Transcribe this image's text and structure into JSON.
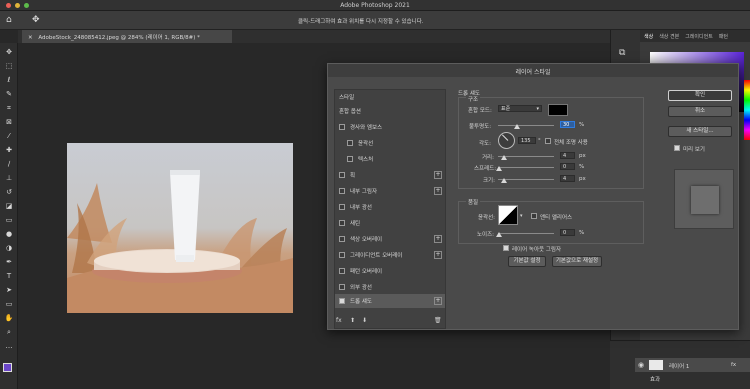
{
  "app": {
    "title": "Adobe Photoshop 2021"
  },
  "options_bar": {
    "hint": "클릭-드래그하여 효과 위치를 다시 지정할 수 있습니다."
  },
  "document": {
    "tab_label": "AdobeStock_248085412.jpeg @ 284% (레이어 1, RGB/8#) *"
  },
  "right_panel": {
    "tabs": [
      "색상",
      "색상 견본",
      "그레이디언트",
      "패턴"
    ]
  },
  "dialog": {
    "title": "레이어 스타일",
    "style_list": [
      {
        "label": "스타일",
        "checkbox": false,
        "checked": false,
        "plus": false,
        "selected": false
      },
      {
        "label": "혼합 옵션",
        "checkbox": false,
        "checked": false,
        "plus": false,
        "selected": false
      },
      {
        "label": "경사와 엠보스",
        "checkbox": true,
        "checked": false,
        "plus": false,
        "selected": false
      },
      {
        "label": "윤곽선",
        "checkbox": true,
        "checked": false,
        "plus": false,
        "selected": false,
        "indent": true
      },
      {
        "label": "텍스처",
        "checkbox": true,
        "checked": false,
        "plus": false,
        "selected": false,
        "indent": true
      },
      {
        "label": "획",
        "checkbox": true,
        "checked": false,
        "plus": true,
        "selected": false
      },
      {
        "label": "내부 그림자",
        "checkbox": true,
        "checked": false,
        "plus": true,
        "selected": false
      },
      {
        "label": "내부 광선",
        "checkbox": true,
        "checked": false,
        "plus": false,
        "selected": false
      },
      {
        "label": "새틴",
        "checkbox": true,
        "checked": false,
        "plus": false,
        "selected": false
      },
      {
        "label": "색상 오버레이",
        "checkbox": true,
        "checked": false,
        "plus": true,
        "selected": false
      },
      {
        "label": "그레이디언트 오버레이",
        "checkbox": true,
        "checked": false,
        "plus": true,
        "selected": false
      },
      {
        "label": "패턴 오버레이",
        "checkbox": true,
        "checked": false,
        "plus": false,
        "selected": false
      },
      {
        "label": "외부 광선",
        "checkbox": true,
        "checked": false,
        "plus": false,
        "selected": false
      },
      {
        "label": "드롭 섀도",
        "checkbox": true,
        "checked": true,
        "plus": true,
        "selected": true
      }
    ],
    "footer": {
      "fx": "fx",
      "up": "⬆",
      "down": "⬇",
      "trash": "🗑"
    },
    "drop_shadow": {
      "heading": "드롭 섀도",
      "structure_heading": "구조",
      "blend_mode_label": "혼합 모드:",
      "blend_mode_value": "표준",
      "shadow_color": "#000000",
      "opacity_label": "불투명도:",
      "opacity_value": "30",
      "opacity_unit": "%",
      "angle_label": "각도:",
      "angle_value": "135",
      "angle_unit": "°",
      "global_light_label": "전체 조명 사용",
      "distance_label": "거리:",
      "distance_value": "4",
      "distance_unit": "px",
      "spread_label": "스프레드:",
      "spread_value": "0",
      "spread_unit": "%",
      "size_label": "크기:",
      "size_value": "4",
      "size_unit": "px",
      "quality_heading": "품질",
      "contour_label": "윤곽선:",
      "antialias_label": "앤티 앨리어스",
      "noise_label": "노이즈:",
      "noise_value": "0",
      "noise_unit": "%",
      "knockout_label": "레이어 녹아웃 그림자",
      "make_default_button": "기본값 설정",
      "reset_default_button": "기본값으로 재설정"
    },
    "buttons": {
      "ok": "확인",
      "cancel": "취소",
      "new_style": "새 스타일...",
      "preview_label": "미리 보기"
    }
  },
  "layers_panel": {
    "layer_name": "레이어 1",
    "effects_label": "효과",
    "fx": "fx"
  },
  "colors": {
    "accent": "#2f7ce0",
    "canvas": "#282828",
    "dialog": "#4a4a4a"
  }
}
